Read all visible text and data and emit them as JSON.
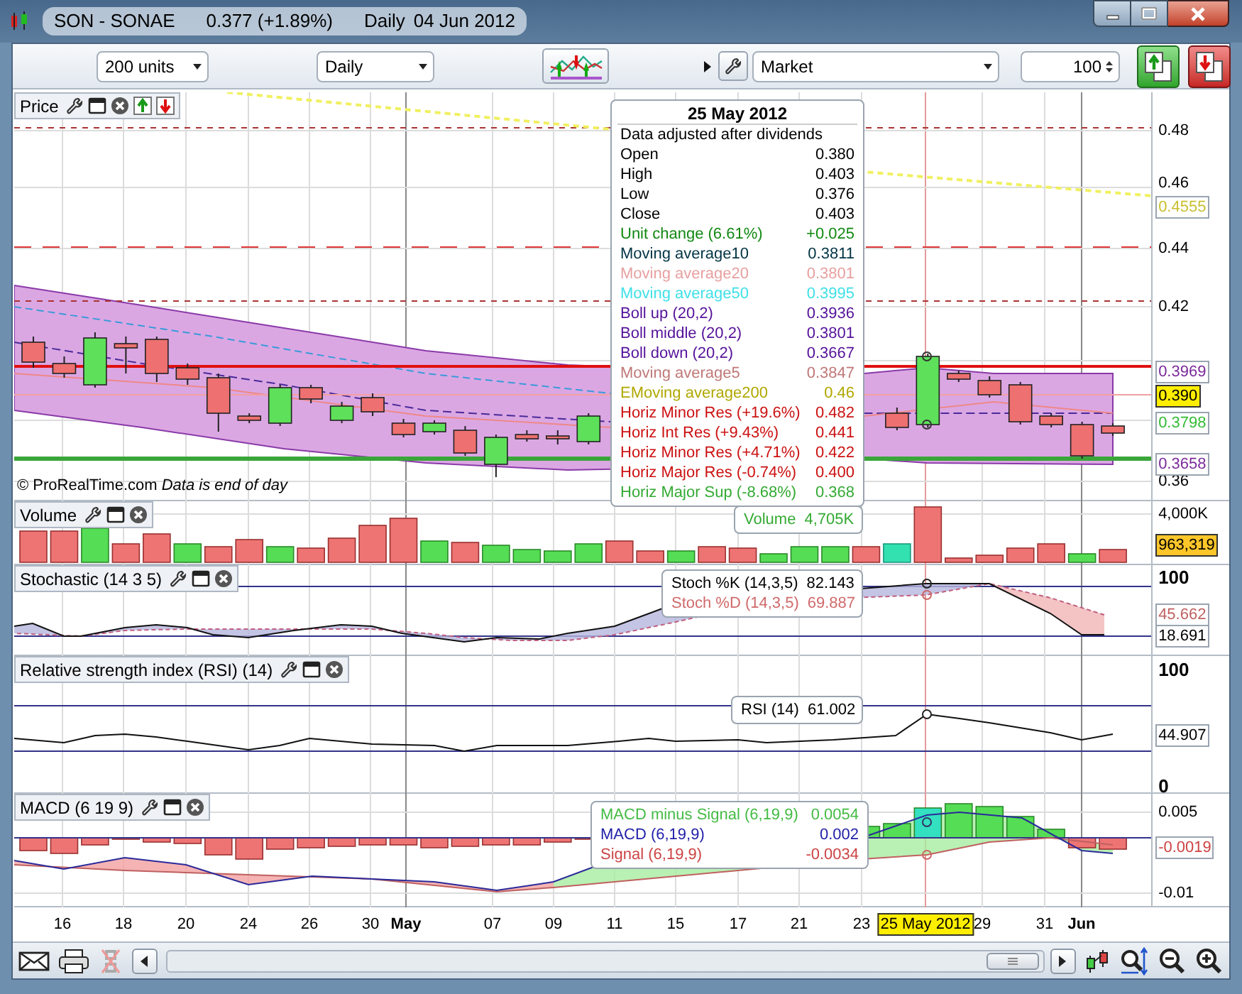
{
  "window": {
    "title": "SON - SONAE",
    "quote": "0.377 (+1.89%)",
    "period": "Daily",
    "date": "04 Jun 2012"
  },
  "toolbar": {
    "units": "200 units",
    "interval": "Daily",
    "order_type": "Market",
    "quantity": "100"
  },
  "panels": [
    {
      "label": "Price",
      "ticks": [
        "0.48",
        "0.46",
        "0.44",
        "0.42",
        "0.36"
      ],
      "badges": [
        {
          "text": "0.4555",
          "color": "#c8c030",
          "kind": "outlined"
        },
        {
          "text": "0.3969",
          "color": "#7a2a9a",
          "kind": "outlined"
        },
        {
          "text": "0.390",
          "kind": "filled"
        },
        {
          "text": "0.3798",
          "color": "#33bb33",
          "kind": "outlined"
        },
        {
          "text": "0.3658",
          "color": "#7a2a9a",
          "kind": "outlined"
        }
      ],
      "credit": "© ProRealTime.com  *Data is end of day*",
      "tooltip": {
        "title": "25 May 2012",
        "note": "Data adjusted after dividends",
        "rows": [
          {
            "label": "Open",
            "value": "0.380",
            "color": "#000000"
          },
          {
            "label": "High",
            "value": "0.403",
            "color": "#000000"
          },
          {
            "label": "Low",
            "value": "0.376",
            "color": "#000000"
          },
          {
            "label": "Close",
            "value": "0.403",
            "color": "#000000"
          },
          {
            "label": "Unit change (6.61%)",
            "value": "+0.025",
            "color": "#118811"
          },
          {
            "label": "Moving average10",
            "value": "0.3811",
            "color": "#003344"
          },
          {
            "label": "Moving average20",
            "value": "0.3801",
            "color": "#e8a0a0"
          },
          {
            "label": "Moving average50",
            "value": "0.3995",
            "color": "#40e0e8"
          },
          {
            "label": "Boll up (20,2)",
            "value": "0.3936",
            "color": "#55119a"
          },
          {
            "label": "Boll middle (20,2)",
            "value": "0.3801",
            "color": "#55119a"
          },
          {
            "label": "Boll down (20,2)",
            "value": "0.3667",
            "color": "#55119a"
          },
          {
            "label": "Moving average5",
            "value": "0.3847",
            "color": "#c07878"
          },
          {
            "label": "EMoving average200",
            "value": "0.46",
            "color": "#b0a800"
          },
          {
            "label": "Horiz Minor Res (+19.6%)",
            "value": "0.482",
            "color": "#cc1111"
          },
          {
            "label": "Horiz Int Res (+9.43%)",
            "value": "0.441",
            "color": "#cc1111"
          },
          {
            "label": "Horiz Minor Res (+4.71%)",
            "value": "0.422",
            "color": "#cc1111"
          },
          {
            "label": "Horiz Major Res (-0.74%)",
            "value": "0.400",
            "color": "#cc1111"
          },
          {
            "label": "Horiz Major Sup (-8.68%)",
            "value": "0.368",
            "color": "#33aa33"
          }
        ]
      }
    },
    {
      "label": "Volume",
      "ticks": [
        "4,000K"
      ],
      "badges": [
        {
          "text": "963,319",
          "kind": "filled"
        }
      ],
      "tooltip": {
        "rows": [
          {
            "label": "Volume",
            "value": "4,705K",
            "color": "#33aa33"
          }
        ]
      }
    },
    {
      "label": "Stochastic (14 3 5)",
      "ticks": [
        "100"
      ],
      "badges": [
        {
          "text": "45.662",
          "color": "#c06060",
          "kind": "outlined"
        },
        {
          "text": "18.691",
          "color": "#000000",
          "kind": "outlined"
        }
      ],
      "tooltip": {
        "rows": [
          {
            "label": "Stoch %K (14,3,5)",
            "value": "82.143",
            "color": "#000000"
          },
          {
            "label": "Stoch %D (14,3,5)",
            "value": "69.887",
            "color": "#d06a6a"
          }
        ]
      }
    },
    {
      "label": "Relative strength index (RSI) (14)",
      "ticks": [
        "100",
        "0"
      ],
      "badges": [
        {
          "text": "44.907",
          "color": "#000000",
          "kind": "outlined"
        }
      ],
      "tooltip": {
        "rows": [
          {
            "label": "RSI (14)",
            "value": "61.002",
            "color": "#000000"
          }
        ]
      }
    },
    {
      "label": "MACD (6 19 9)",
      "ticks": [
        "0.005",
        "-0.01"
      ],
      "badges": [
        {
          "text": "-0.0019",
          "color": "#cc4444",
          "kind": "outlined"
        }
      ],
      "tooltip": {
        "rows": [
          {
            "label": "MACD minus Signal (6,19,9)",
            "value": "0.0054",
            "color": "#44bb44"
          },
          {
            "label": "MACD (6,19,9)",
            "value": "0.002",
            "color": "#2222aa"
          },
          {
            "label": "Signal (6,19,9)",
            "value": "-0.0034",
            "color": "#cc4444"
          }
        ]
      }
    }
  ],
  "dates": [
    {
      "label": "16",
      "kind": "day",
      "selected": false
    },
    {
      "label": "18",
      "kind": "day",
      "selected": false
    },
    {
      "label": "20",
      "kind": "day",
      "selected": false
    },
    {
      "label": "24",
      "kind": "day",
      "selected": false
    },
    {
      "label": "26",
      "kind": "day",
      "selected": false
    },
    {
      "label": "30",
      "kind": "day",
      "selected": false
    },
    {
      "label": "May",
      "kind": "month",
      "selected": false
    },
    {
      "label": "07",
      "kind": "day",
      "selected": false
    },
    {
      "label": "09",
      "kind": "day",
      "selected": false
    },
    {
      "label": "11",
      "kind": "day",
      "selected": false
    },
    {
      "label": "15",
      "kind": "day",
      "selected": false
    },
    {
      "label": "17",
      "kind": "day",
      "selected": false
    },
    {
      "label": "21",
      "kind": "day",
      "selected": false
    },
    {
      "label": "23",
      "kind": "day",
      "selected": false
    },
    {
      "label": "25 May 2012",
      "kind": "day",
      "selected": true
    },
    {
      "label": "29",
      "kind": "day",
      "selected": false
    },
    {
      "label": "31",
      "kind": "day",
      "selected": false
    },
    {
      "label": "Jun",
      "kind": "month",
      "selected": false
    }
  ]
}
